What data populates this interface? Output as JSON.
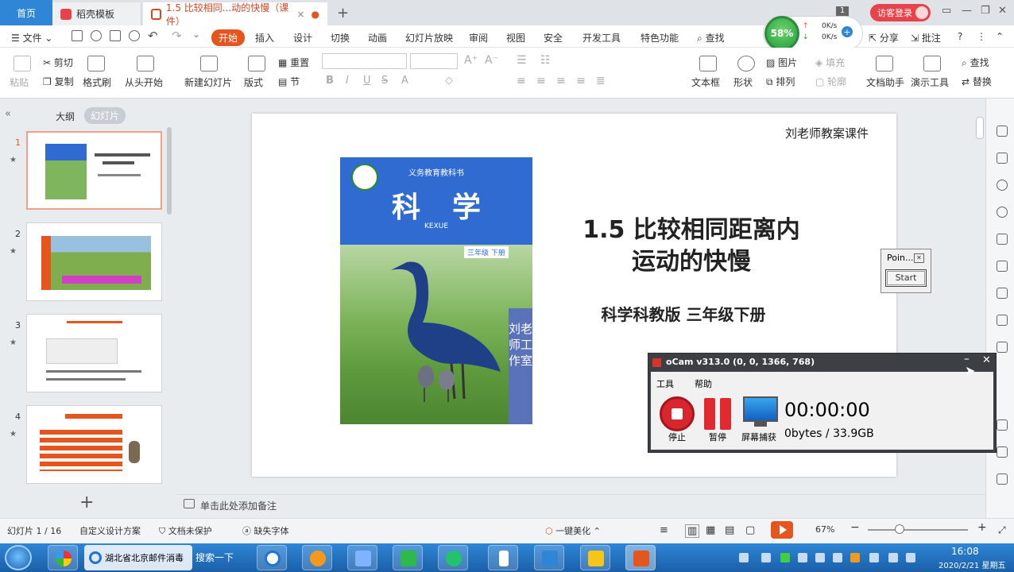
{
  "window": {
    "tabs": [
      {
        "label": "首页"
      },
      {
        "label": "稻壳模板"
      },
      {
        "label": "1.5 比较相同...动的快慢（课件）"
      }
    ],
    "badge": "1",
    "login_label": "访客登录"
  },
  "net_widget": {
    "percent": "58%",
    "up": "0K/s",
    "down": "0K/s"
  },
  "menu": {
    "file": "文件",
    "items": [
      "开始",
      "插入",
      "设计",
      "切换",
      "动画",
      "幻灯片放映",
      "审阅",
      "视图",
      "安全",
      "开发工具",
      "特色功能"
    ],
    "search": "查找",
    "share": "分享",
    "annotate": "批注"
  },
  "ribbon": {
    "paste": "粘贴",
    "cut": "剪切",
    "copy": "复制",
    "format_painter": "格式刷",
    "from_start": "从头开始",
    "new_slide": "新建幻灯片",
    "layout": "版式",
    "reset": "重置",
    "section": "节",
    "textbox": "文本框",
    "shape": "形状",
    "picture": "图片",
    "fill": "填充",
    "arrange": "排列",
    "outline": "轮廓",
    "doc_helper": "文档助手",
    "present_tools": "演示工具",
    "find": "查找",
    "replace": "替换"
  },
  "left_panel": {
    "outline_tab": "大纲",
    "slides_tab": "幻灯片",
    "slide_numbers": [
      "1",
      "2",
      "3",
      "4"
    ]
  },
  "slide": {
    "corner_label": "刘老师教案课件",
    "title_line1": "1.5 比较相同距离内",
    "title_line2": "运动的快慢",
    "subtitle": "科学科教版   三年级下册",
    "book": {
      "series": "义务教育教科书",
      "title": "科学",
      "pinyin": "KEXUE",
      "grade": "三年级 下册",
      "side_text": "刘老师工作室"
    }
  },
  "notes": {
    "placeholder": "单击此处添加备注"
  },
  "status": {
    "slide_count": "幻灯片 1 / 16",
    "design": "自定义设计方案",
    "protect": "文档未保护",
    "missing_font": "缺失字体",
    "beautify": "一键美化",
    "zoom": "67%"
  },
  "point_widget": {
    "title": "Poin...",
    "start": "Start"
  },
  "ocam": {
    "title": "oCam v313.0 (0, 0, 1366, 768)",
    "menu_tools": "工具",
    "menu_help": "帮助",
    "stop": "停止",
    "pause": "暂停",
    "capture": "屏幕捕获",
    "time": "00:00:00",
    "size": "0bytes / 33.9GB"
  },
  "taskbar": {
    "browser_label": "湖北省北京邮件消毒",
    "search_label": "搜索一下",
    "time": "16:08",
    "date": "2020/2/21 星期五"
  },
  "colors": {
    "accent": "#e5561f",
    "home_tab": "#2f86d6",
    "book_blue": "#2f6bd1",
    "login": "#e6434b"
  }
}
